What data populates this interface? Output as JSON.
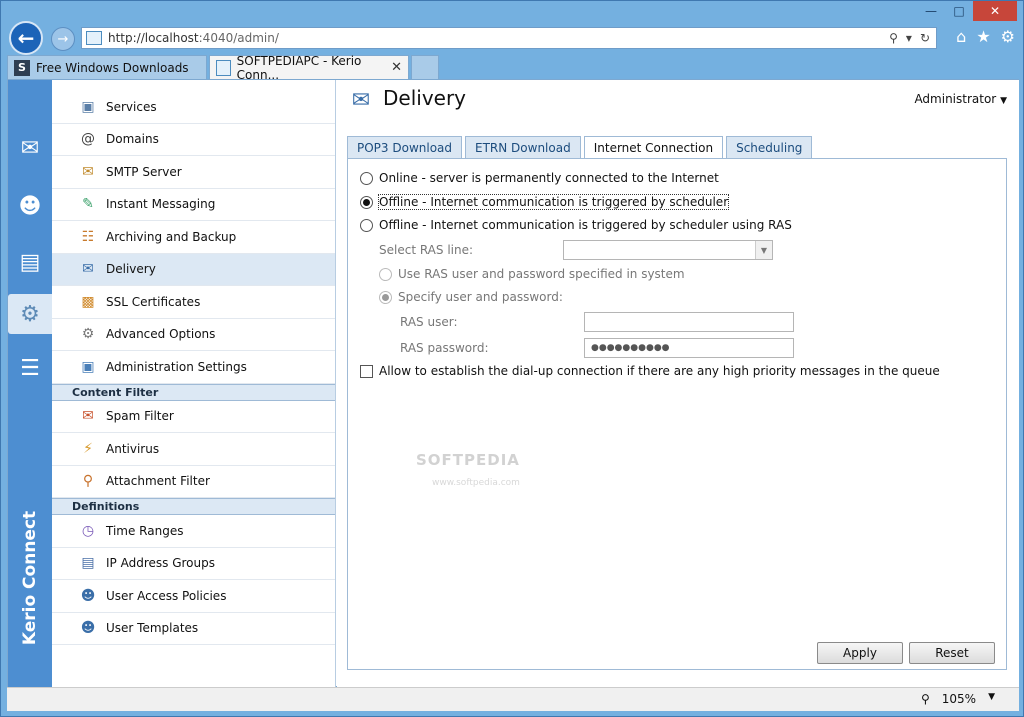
{
  "browser": {
    "url_host": "http://localhost",
    "url_rest": ":4040/admin/",
    "tabs": [
      {
        "label": "Free Windows Downloads",
        "favicon": "S"
      },
      {
        "label": "SOFTPEDIAPC - Kerio Conn...",
        "close": "✕"
      }
    ],
    "zoom": "105%"
  },
  "rail": {
    "brand": "Kerio Connect",
    "items": [
      "mail-icon",
      "users-icon",
      "chart-icon",
      "gear-icon",
      "document-icon"
    ]
  },
  "menu": {
    "items": [
      {
        "label": "Services",
        "icon": "services-icon"
      },
      {
        "label": "Domains",
        "icon": "at-icon"
      },
      {
        "label": "SMTP Server",
        "icon": "envelope-icon"
      },
      {
        "label": "Instant Messaging",
        "icon": "chat-icon"
      },
      {
        "label": "Archiving and Backup",
        "icon": "archive-icon"
      },
      {
        "label": "Delivery",
        "icon": "delivery-icon"
      },
      {
        "label": "SSL Certificates",
        "icon": "certificate-icon"
      },
      {
        "label": "Advanced Options",
        "icon": "advanced-gear-icon"
      },
      {
        "label": "Administration Settings",
        "icon": "admin-icon"
      }
    ],
    "content_filter_header": "Content Filter",
    "content_filter": [
      {
        "label": "Spam Filter",
        "icon": "spam-icon"
      },
      {
        "label": "Antivirus",
        "icon": "antivirus-icon"
      },
      {
        "label": "Attachment Filter",
        "icon": "attachment-icon"
      }
    ],
    "definitions_header": "Definitions",
    "definitions": [
      {
        "label": "Time Ranges",
        "icon": "clock-icon"
      },
      {
        "label": "IP Address Groups",
        "icon": "ip-book-icon"
      },
      {
        "label": "User Access Policies",
        "icon": "policy-icon"
      },
      {
        "label": "User Templates",
        "icon": "template-icon"
      }
    ]
  },
  "main": {
    "title": "Delivery",
    "user": "Administrator",
    "tabs": [
      "POP3 Download",
      "ETRN Download",
      "Internet Connection",
      "Scheduling"
    ],
    "options": {
      "online": "Online - server is permanently connected to the Internet",
      "offline_scheduler": "Offline - Internet communication is triggered by scheduler",
      "offline_ras": "Offline - Internet communication is triggered by scheduler using RAS"
    },
    "ras": {
      "select_label": "Select RAS line:",
      "use_system": "Use RAS user and password specified in system",
      "specify": "Specify user and password:",
      "user_label": "RAS user:",
      "password_label": "RAS password:",
      "password_value": "●●●●●●●●●●"
    },
    "dialup": "Allow to establish the dial-up connection if there are any high priority messages in the queue",
    "apply": "Apply",
    "reset": "Reset"
  },
  "watermark": {
    "title": "SOFTPEDIA",
    "sub": "www.softpedia.com"
  }
}
